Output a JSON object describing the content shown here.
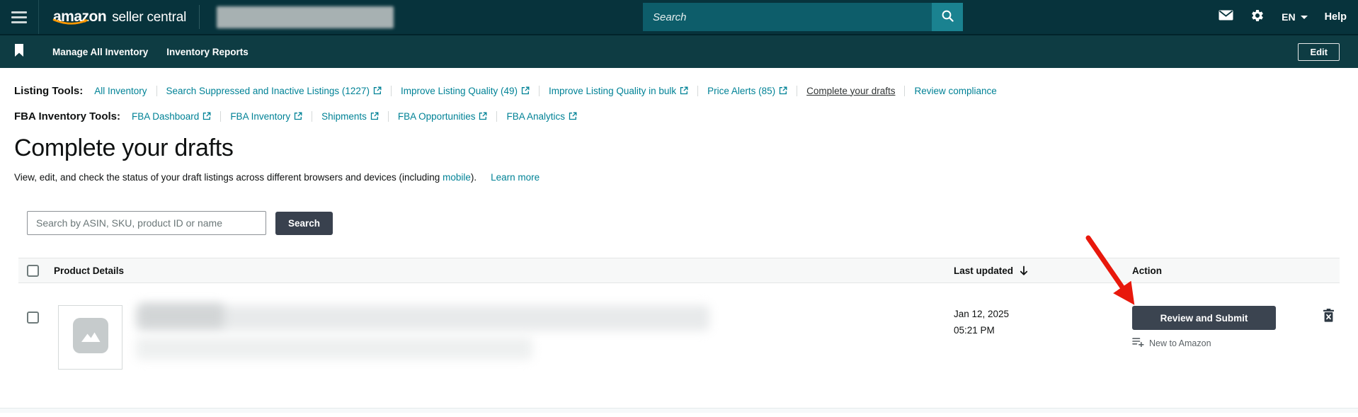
{
  "colors": {
    "header_bg": "#07333c",
    "subnav_bg": "#0e3c43",
    "search_field_bg": "#0d5d6a",
    "search_button_bg": "#1a8290",
    "link_teal": "#008296",
    "dark_button": "#3b4450",
    "amazon_orange": "#ff9900",
    "annotation_red": "#e8180c"
  },
  "header": {
    "logo_primary": "amazon",
    "logo_secondary": "seller central",
    "search_placeholder": "Search",
    "language": "EN",
    "help_label": "Help"
  },
  "nav": {
    "items": [
      {
        "label": "Manage All Inventory"
      },
      {
        "label": "Inventory Reports"
      }
    ],
    "edit_label": "Edit"
  },
  "listing_tools": {
    "label": "Listing Tools:",
    "links": [
      {
        "label": "All Inventory",
        "external": false
      },
      {
        "label": "Search Suppressed and Inactive Listings (1227)",
        "external": true
      },
      {
        "label": "Improve Listing Quality (49)",
        "external": true
      },
      {
        "label": "Improve Listing Quality in bulk",
        "external": true
      },
      {
        "label": "Price Alerts (85)",
        "external": true
      },
      {
        "label": "Complete your drafts",
        "external": false,
        "active": true
      },
      {
        "label": "Review compliance",
        "external": false
      }
    ]
  },
  "fba_tools": {
    "label": "FBA Inventory Tools:",
    "links": [
      {
        "label": "FBA Dashboard",
        "external": true
      },
      {
        "label": "FBA Inventory",
        "external": true
      },
      {
        "label": "Shipments",
        "external": true
      },
      {
        "label": "FBA Opportunities",
        "external": true
      },
      {
        "label": "FBA Analytics",
        "external": true
      }
    ]
  },
  "page": {
    "title": "Complete your drafts",
    "description_before": "View, edit, and check the status of your draft listings across different browsers and devices (including ",
    "mobile_link": "mobile",
    "description_after": ").",
    "learn_more": "Learn more"
  },
  "search": {
    "placeholder": "Search by ASIN, SKU, product ID or name",
    "button_label": "Search"
  },
  "table": {
    "headers": {
      "product": "Product Details",
      "last_updated": "Last updated",
      "action": "Action"
    },
    "rows": [
      {
        "last_updated_date": "Jan 12, 2025",
        "last_updated_time": "05:21 PM",
        "action_label": "Review and Submit",
        "badge": "New to Amazon"
      }
    ]
  }
}
